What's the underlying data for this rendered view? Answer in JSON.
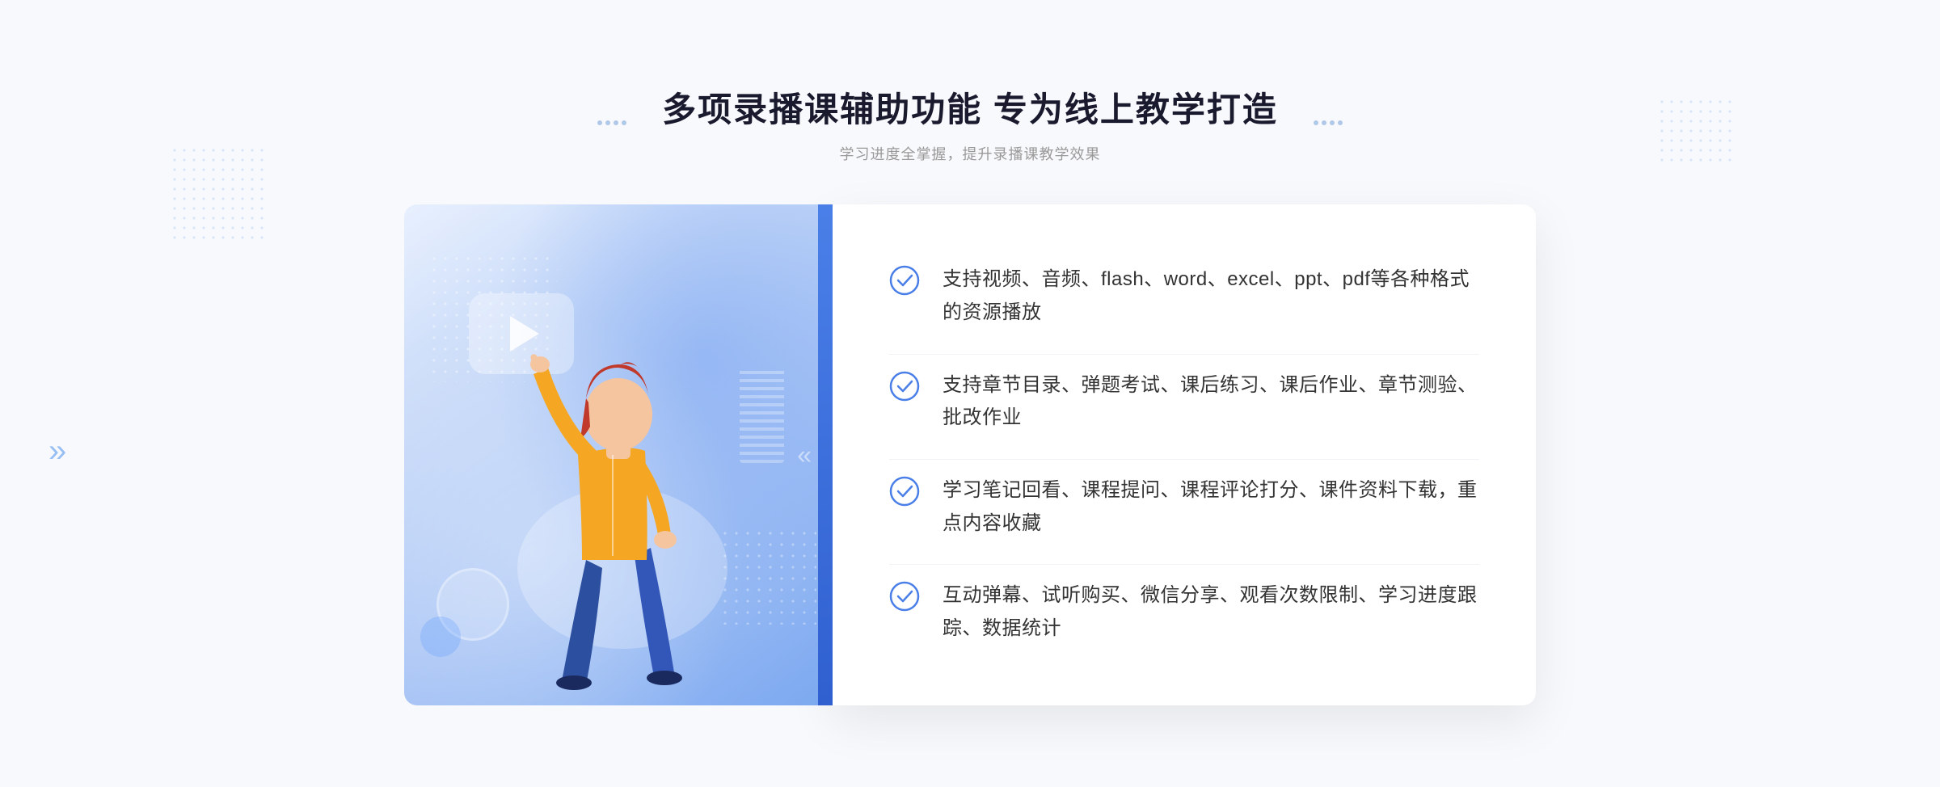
{
  "page": {
    "background_color": "#f8f9fc"
  },
  "header": {
    "main_title": "多项录播课辅助功能 专为线上教学打造",
    "sub_title": "学习进度全掌握，提升录播课教学效果"
  },
  "features": [
    {
      "id": "feature-1",
      "text": "支持视频、音频、flash、word、excel、ppt、pdf等各种格式的资源播放"
    },
    {
      "id": "feature-2",
      "text": "支持章节目录、弹题考试、课后练习、课后作业、章节测验、批改作业"
    },
    {
      "id": "feature-3",
      "text": "学习笔记回看、课程提问、课程评论打分、课件资料下载，重点内容收藏"
    },
    {
      "id": "feature-4",
      "text": "互动弹幕、试听购买、微信分享、观看次数限制、学习进度跟踪、数据统计"
    }
  ],
  "icons": {
    "check_circle": "✓",
    "play": "▶",
    "chevron_right": "»"
  },
  "colors": {
    "primary_blue": "#4a7fe8",
    "light_blue": "#a8c8f8",
    "text_dark": "#1a1a2e",
    "text_gray": "#999999",
    "text_body": "#333333",
    "check_color": "#4a7fe8",
    "white": "#ffffff"
  }
}
